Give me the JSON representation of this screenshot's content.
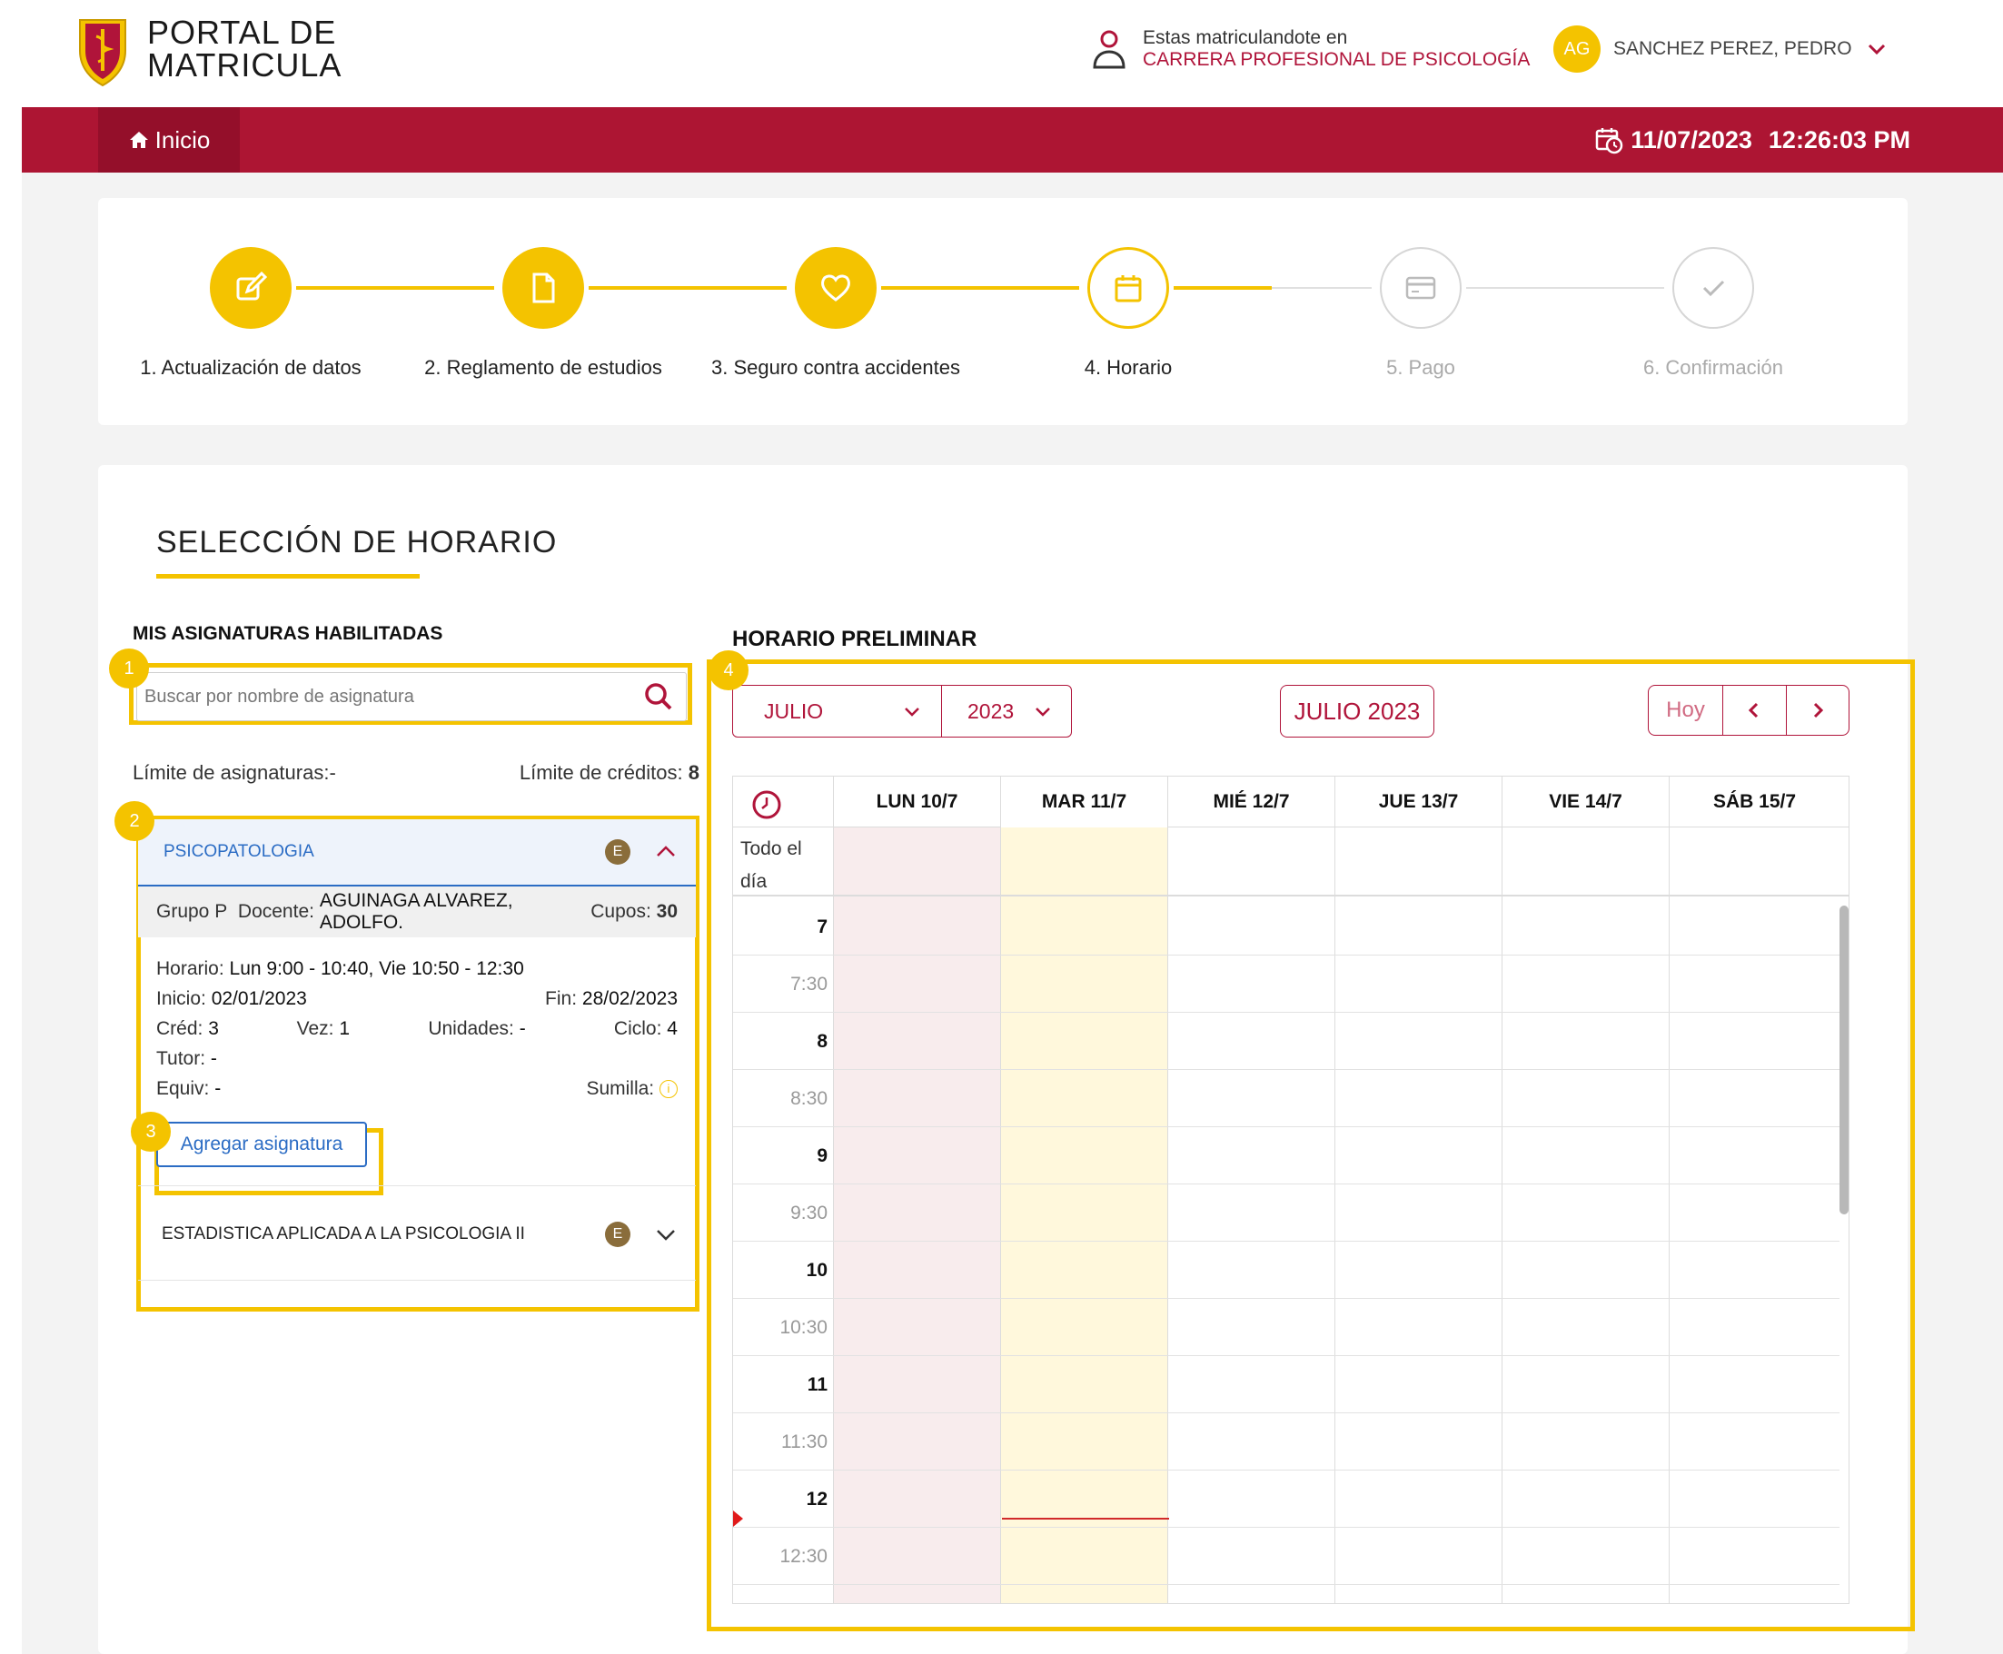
{
  "header": {
    "brand_line1": "PORTAL DE",
    "brand_line2": "MATRICULA",
    "enroll_label": "Estas matriculandote en",
    "career": "CARRERA PROFESIONAL DE PSICOLOGÍA",
    "avatar_initials": "AG",
    "user_name": "SANCHEZ PEREZ, PEDRO"
  },
  "nav": {
    "home_label": "Inicio",
    "date": "11/07/2023",
    "time": "12:26:03 PM"
  },
  "colors": {
    "accent": "#f4c300",
    "brand": "#ad1533",
    "link": "#2b6cc4"
  },
  "steps": [
    {
      "label": "1. Actualización de datos",
      "icon": "edit-icon",
      "state": "done"
    },
    {
      "label": "2. Reglamento de estudios",
      "icon": "document-icon",
      "state": "done"
    },
    {
      "label": "3. Seguro contra accidentes",
      "icon": "heart-icon",
      "state": "done"
    },
    {
      "label": "4. Horario",
      "icon": "calendar-icon",
      "state": "current"
    },
    {
      "label": "5. Pago",
      "icon": "card-icon",
      "state": "todo"
    },
    {
      "label": "6. Confirmación",
      "icon": "check-icon",
      "state": "todo"
    }
  ],
  "page_title": "SELECCIÓN DE HORARIO",
  "left": {
    "heading": "MIS ASIGNATURAS HABILITADAS",
    "search_placeholder": "Buscar por nombre de asignatura",
    "limit_subjects_label": "Límite de asignaturas:",
    "limit_subjects_value": "-",
    "limit_credits_label": "Límite de créditos:",
    "limit_credits_value": "8",
    "courses": [
      {
        "name": "PSICOPATOLOGIA",
        "badge": "E",
        "expanded": true,
        "group_label": "Grupo",
        "group": "P",
        "teacher_label": "Docente:",
        "teacher": "AGUINAGA ALVAREZ, ADOLFO.",
        "seats_label": "Cupos:",
        "seats": "30",
        "schedule_label": "Horario:",
        "schedule": "Lun 9:00 - 10:40, Vie 10:50 - 12:30",
        "start_label": "Inicio:",
        "start": "02/01/2023",
        "end_label": "Fin:",
        "end": "28/02/2023",
        "credits_label": "Créd:",
        "credits": "3",
        "times_label": "Vez:",
        "times": "1",
        "units_label": "Unidades:",
        "units": "-",
        "cycle_label": "Ciclo:",
        "cycle": "4",
        "tutor_label": "Tutor:",
        "tutor": "-",
        "equiv_label": "Equiv:",
        "equiv": "-",
        "summary_label": "Sumilla:",
        "add_button": "Agregar asignatura"
      },
      {
        "name": "ESTADISTICA APLICADA A LA PSICOLOGIA II",
        "badge": "E",
        "expanded": false
      }
    ]
  },
  "callouts": [
    "1",
    "2",
    "3",
    "4"
  ],
  "calendar": {
    "heading": "HORARIO PRELIMINAR",
    "month_select": "JULIO",
    "year_select": "2023",
    "current_month": "JULIO 2023",
    "today_label": "Hoy",
    "days": [
      "LUN 10/7",
      "MAR 11/7",
      "MIÉ 12/7",
      "JUE 13/7",
      "VIE 14/7",
      "SÁB 15/7"
    ],
    "allday_label": "Todo el día",
    "time_slots": [
      "7",
      "7:30",
      "8",
      "8:30",
      "9",
      "9:30",
      "10",
      "10:30",
      "11",
      "11:30",
      "12",
      "12:30"
    ]
  }
}
